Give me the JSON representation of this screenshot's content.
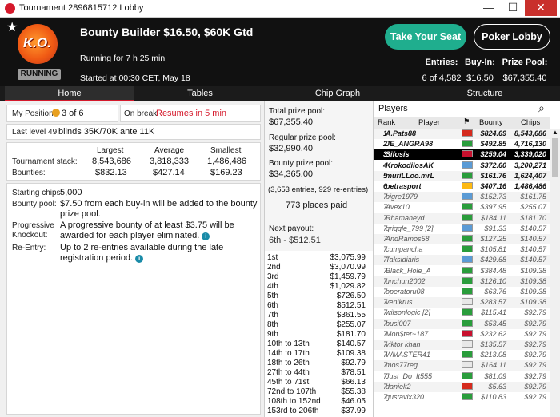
{
  "window": {
    "title": "Tournament 2896815712 Lobby",
    "controls": [
      "—",
      "☐",
      "✕"
    ]
  },
  "header": {
    "logo_text": "K.O.",
    "status_badge": "RUNNING",
    "tournament_name": "Bounty Builder $16.50, $60K Gtd",
    "running_for": "Running for 7 h 25 min",
    "started_at": "Started at 00:30 CET, May 18",
    "take_seat": "Take Your Seat",
    "poker_lobby": "Poker Lobby",
    "stats": [
      {
        "label": "Entries:",
        "value": "6 of 4,582"
      },
      {
        "label": "Buy-In:",
        "value": "$16.50"
      },
      {
        "label": "Prize Pool:",
        "value": "$67,355.40"
      }
    ]
  },
  "tabs": [
    "Home",
    "Tables",
    "Chip Graph",
    "Structure"
  ],
  "home": {
    "my_position_label": "My Position:",
    "my_position_value": "3 of 6",
    "on_break_label": "On break:",
    "on_break_value": "Resumes in 5 min",
    "last_level": "Last level 49:",
    "blinds": "blinds 35K/70K ante 11K",
    "stack_headers": [
      "Largest",
      "Average",
      "Smallest"
    ],
    "stack_label": "Tournament stack:",
    "stack_values": [
      "8,543,686",
      "3,818,333",
      "1,486,486"
    ],
    "bounty_label": "Bounties:",
    "bounty_values": [
      "$832.13",
      "$427.14",
      "$169.23"
    ],
    "starting_chips_label": "Starting chips:",
    "starting_chips": "5,000",
    "bounty_pool_label": "Bounty pool:",
    "bounty_pool": "$7.50 from each buy-in will be added to the bounty prize pool.",
    "pko_label": "Progressive Knockout:",
    "pko": "A progressive bounty of at least $3.75 will be awarded for each player eliminated.",
    "reentry_label": "Re-Entry:",
    "reentry": "Up to 2 re-entries available during the late registration period."
  },
  "prizes": {
    "total_label": "Total prize pool:",
    "total": "$67,355.40",
    "regular_label": "Regular prize pool:",
    "regular": "$32,990.40",
    "bounty_label": "Bounty prize pool:",
    "bounty": "$34,365.00",
    "entries_note": "(3,653 entries, 929 re-entries)",
    "places_paid": "773 places paid",
    "next_payout_label": "Next payout:",
    "next_payout": "6th - $512.51",
    "payouts": [
      [
        "1st",
        "$3,075.99"
      ],
      [
        "2nd",
        "$3,070.99"
      ],
      [
        "3rd",
        "$1,459.79"
      ],
      [
        "4th",
        "$1,029.82"
      ],
      [
        "5th",
        "$726.50"
      ],
      [
        "6th",
        "$512.51"
      ],
      [
        "7th",
        "$361.55"
      ],
      [
        "8th",
        "$255.07"
      ],
      [
        "9th",
        "$181.70"
      ],
      [
        "10th to 13th",
        "$140.57"
      ],
      [
        "14th to 17th",
        "$109.38"
      ],
      [
        "18th to 26th",
        "$92.79"
      ],
      [
        "27th to 44th",
        "$78.51"
      ],
      [
        "45th to 71st",
        "$66.13"
      ],
      [
        "72nd to 107th",
        "$55.38"
      ],
      [
        "108th to 152nd",
        "$46.05"
      ],
      [
        "153rd to 206th",
        "$37.99"
      ]
    ]
  },
  "players": {
    "title": "Players",
    "columns": [
      "Rank",
      "Player",
      "Bounty",
      "Chips"
    ],
    "rows": [
      [
        "1",
        "A.Pats88",
        "$824.69",
        "8,543,686",
        "#d52b1e"
      ],
      [
        "2",
        "JE_ANGRA98",
        "$492.85",
        "4,716,130",
        "#2a9d3c"
      ],
      [
        "3",
        "Sifosis",
        "$259.04",
        "3,339,020",
        "#c8102e"
      ],
      [
        "4",
        "KrokodilosAK",
        "$372.60",
        "3,200,271",
        "#5b9bd5"
      ],
      [
        "5",
        "muriLLoo.mrL",
        "$161.76",
        "1,624,407",
        "#2a9d3c"
      ],
      [
        "6",
        "petrasport",
        "$407.16",
        "1,486,486",
        "#fdb913"
      ],
      [
        "7",
        "bigre1979",
        "$152.73",
        "$161.75",
        "#5b9bd5"
      ],
      [
        "7",
        "Avex10",
        "$397.95",
        "$255.07",
        "#2a9d3c"
      ],
      [
        "7",
        "Rhamaneyd",
        "$184.11",
        "$181.70",
        "#2a9d3c"
      ],
      [
        "7",
        "griggle_799 [2]",
        "$91.33",
        "$140.57",
        "#5b9bd5"
      ],
      [
        "7",
        "AndRamos58",
        "$127.25",
        "$140.57",
        "#2a9d3c"
      ],
      [
        "7",
        "cumpancha",
        "$105.81",
        "$140.57",
        "#2a9d3c"
      ],
      [
        "7",
        "Taksidiaris",
        "$429.68",
        "$140.57",
        "#5b9bd5"
      ],
      [
        "7",
        "Black_Hole_A",
        "$384.48",
        "$109.38",
        "#2a9d3c"
      ],
      [
        "7",
        "unchun2002",
        "$126.10",
        "$109.38",
        "#2a9d3c"
      ],
      [
        "7",
        "operatoru08",
        "$63.76",
        "$109.38",
        "#2a9d3c"
      ],
      [
        "7",
        "venikrus",
        "$283.57",
        "$109.38",
        "#e8e8e8"
      ],
      [
        "7",
        "wilsonlogic [2]",
        "$115.41",
        "$92.79",
        "#2a9d3c"
      ],
      [
        "7",
        "busi007",
        "$53.45",
        "$92.79",
        "#2a9d3c"
      ],
      [
        "7",
        "Mon$ter~187",
        "$232.62",
        "$92.79",
        "#c8102e"
      ],
      [
        "7",
        "viktor khan",
        "$135.57",
        "$92.79",
        "#e8e8e8"
      ],
      [
        "7",
        "WMASTER41",
        "$213.08",
        "$92.79",
        "#2a9d3c"
      ],
      [
        "7",
        "mos77reg",
        "$164.11",
        "$92.79",
        "#e8e8e8"
      ],
      [
        "7",
        "Just_Do_It555",
        "$81.09",
        "$92.79",
        "#2a9d3c"
      ],
      [
        "7",
        "danielt2",
        "$5.63",
        "$92.79",
        "#d52b1e"
      ],
      [
        "7",
        "gustavix320",
        "$110.83",
        "$92.79",
        "#2a9d3c"
      ]
    ]
  }
}
